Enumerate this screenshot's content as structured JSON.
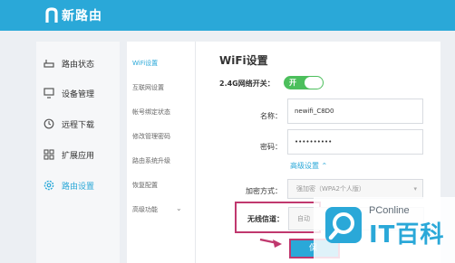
{
  "app": {
    "title": "新路由"
  },
  "colors": {
    "brand": "#2aa8d8",
    "toggle_on": "#4cbf5c",
    "highlight": "#c0386e",
    "watermark_brand": "#2aa8d8"
  },
  "sidebar": {
    "items": [
      {
        "label": "路由状态",
        "icon": "router-icon"
      },
      {
        "label": "设备管理",
        "icon": "monitor-icon"
      },
      {
        "label": "远程下载",
        "icon": "clock-icon"
      },
      {
        "label": "扩展应用",
        "icon": "grid-icon"
      },
      {
        "label": "路由设置",
        "icon": "gear-icon",
        "active": true
      }
    ]
  },
  "subnav": {
    "items": [
      {
        "label": "WiFi设置",
        "active": true
      },
      {
        "label": "互联网设置"
      },
      {
        "label": "帐号绑定状态"
      },
      {
        "label": "修改管理密码"
      },
      {
        "label": "路由系统升级"
      },
      {
        "label": "恢复配置"
      },
      {
        "label": "高级功能"
      }
    ]
  },
  "content": {
    "title": "WiFi设置",
    "band_switch": {
      "label": "2.4G网络开关：",
      "state": "开"
    },
    "ssid": {
      "label": "名称：",
      "value": "newifi_C8D0"
    },
    "password": {
      "label": "密码：",
      "value": "••••••••••"
    },
    "advanced": {
      "label": "高级设置",
      "icon": "chevron-up-icon"
    },
    "encryption": {
      "label": "加密方式：",
      "value": "强加密（WPA2个人版）"
    },
    "channel": {
      "label": "无线信道：",
      "value": "自动"
    },
    "save_label": "保"
  },
  "watermark": {
    "brand": "PConline",
    "big": "IT百科"
  }
}
